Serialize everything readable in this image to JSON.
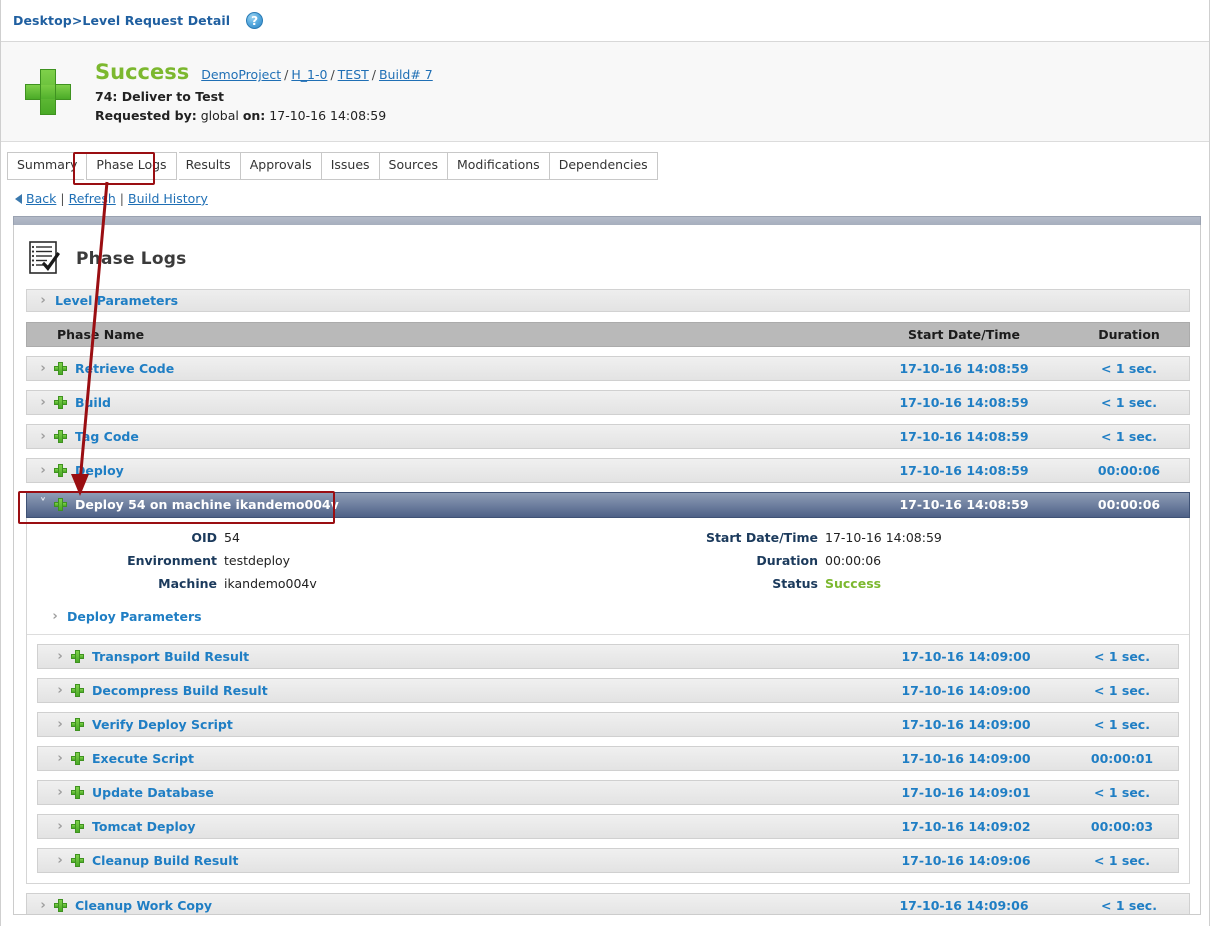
{
  "breadcrumb": {
    "text": "Desktop>Level Request Detail",
    "help_icon": "help-icon",
    "help_glyph": "?"
  },
  "status": {
    "icon": "green-plus-icon",
    "word": "Success",
    "links": [
      {
        "label": "DemoProject"
      },
      {
        "label": "H_1-0"
      },
      {
        "label": "TEST"
      },
      {
        "label": "Build# 7"
      }
    ],
    "separator": "/",
    "subtitle": "74: Deliver to Test",
    "requested_label": "Requested by:",
    "requested_user": "global",
    "on_label": "on:",
    "on_value": "17-10-16 14:08:59"
  },
  "tabs": [
    {
      "label": "Summary",
      "selected": false
    },
    {
      "label": "Phase Logs",
      "selected": true
    },
    {
      "label": "Results",
      "selected": false
    },
    {
      "label": "Approvals",
      "selected": false
    },
    {
      "label": "Issues",
      "selected": false
    },
    {
      "label": "Sources",
      "selected": false
    },
    {
      "label": "Modifications",
      "selected": false
    },
    {
      "label": "Dependencies",
      "selected": false
    }
  ],
  "navlinks": {
    "back": "Back",
    "refresh": "Refresh",
    "build_history": "Build History",
    "pipe": "|"
  },
  "panel": {
    "icon": "checklist-icon",
    "title": "Phase Logs",
    "level_parameters": "Level Parameters",
    "chevron_collapsed": "›",
    "chevron_expanded": "˅"
  },
  "table": {
    "headers": {
      "name": "Phase Name",
      "date": "Start Date/Time",
      "duration": "Duration"
    },
    "rows": [
      {
        "name": "Retrieve Code",
        "date": "17-10-16 14:08:59",
        "duration": "< 1 sec."
      },
      {
        "name": "Build",
        "date": "17-10-16 14:08:59",
        "duration": "< 1 sec."
      },
      {
        "name": "Tag Code",
        "date": "17-10-16 14:08:59",
        "duration": "< 1 sec."
      },
      {
        "name": "Deploy",
        "date": "17-10-16 14:08:59",
        "duration": "00:00:06"
      }
    ],
    "selected_row": {
      "name": "Deploy 54 on machine ikandemo004v",
      "date": "17-10-16 14:08:59",
      "duration": "00:00:06"
    },
    "last_row": {
      "name": "Cleanup Work Copy",
      "date": "17-10-16 14:09:06",
      "duration": "< 1 sec."
    }
  },
  "detail": {
    "left": [
      {
        "label": "OID",
        "value": "54"
      },
      {
        "label": "Environment",
        "value": "testdeploy"
      },
      {
        "label": "Machine",
        "value": "ikandemo004v"
      }
    ],
    "right": [
      {
        "label": "Start Date/Time",
        "value": "17-10-16 14:08:59"
      },
      {
        "label": "Duration",
        "value": "00:00:06"
      },
      {
        "label": "Status",
        "value": "Success",
        "status": true
      }
    ],
    "deploy_parameters": "Deploy Parameters",
    "subrows": [
      {
        "name": "Transport Build Result",
        "date": "17-10-16 14:09:00",
        "duration": "< 1 sec."
      },
      {
        "name": "Decompress Build Result",
        "date": "17-10-16 14:09:00",
        "duration": "< 1 sec."
      },
      {
        "name": "Verify Deploy Script",
        "date": "17-10-16 14:09:00",
        "duration": "< 1 sec."
      },
      {
        "name": "Execute Script",
        "date": "17-10-16 14:09:00",
        "duration": "00:00:01"
      },
      {
        "name": "Update Database",
        "date": "17-10-16 14:09:01",
        "duration": "< 1 sec."
      },
      {
        "name": "Tomcat Deploy",
        "date": "17-10-16 14:09:02",
        "duration": "00:00:03"
      },
      {
        "name": "Cleanup Build Result",
        "date": "17-10-16 14:09:06",
        "duration": "< 1 sec."
      }
    ]
  },
  "annotation": {
    "color": "#9a0e12",
    "description": "arrow from Phase Logs tab to selected Deploy 54 row"
  },
  "colors": {
    "link": "#1f7ec4",
    "success": "#7cb82f",
    "header_gray": "#b9b9b9",
    "selected_row": "#4e6187",
    "annotation_red": "#9a0e12"
  }
}
